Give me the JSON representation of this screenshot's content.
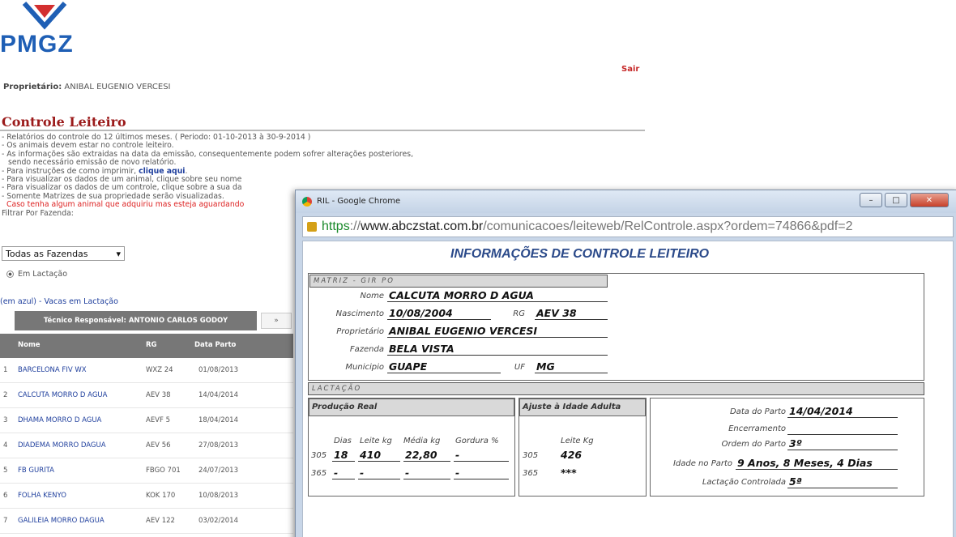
{
  "logo": {
    "text": "PMGZ",
    "mark_icon": "pmgz-logo-icon",
    "color": "#1f5fb5"
  },
  "header": {
    "sair": "Sair",
    "owner_label": "Proprietário:",
    "owner_name": "ANIBAL EUGENIO VERCESI"
  },
  "page_title": "Controle Leiteiro",
  "notes": {
    "l1": "- Relatórios do controle do 12 últimos meses. ( Periodo: 01-10-2013 à 30-9-2014 )",
    "l2": "- Os animais devem estar no controle leiteiro.",
    "l3": "- As informações são extraidas na data da emissão, consequentemente podem sofrer alterações posteriores,",
    "l4": "sendo necessário emissão de novo relatório.",
    "l5_pre": "- Para instruções de como imprimir, ",
    "l5_link": "clique aqui",
    "l5_post": ".",
    "l6": "- Para visualizar os dados de um animal, clique sobre seu nome",
    "l7": "- Para visualizar os dados de um controle, clique sobre a sua da",
    "l8": "- Somente Matrizes de sua propriedade serão visualizadas.",
    "l9": "Caso tenha algum animal que adquiriu mas esteja aguardando"
  },
  "filter": {
    "label": "Filtrar Por Fazenda:",
    "selected": "Todas as Fazendas",
    "radio": "Em Lactação",
    "legend": "(em azul) - Vacas em Lactação"
  },
  "tecnico": {
    "label": "Técnico Responsável: ANTONIO CARLOS GODOY",
    "button": "»"
  },
  "table": {
    "headers": {
      "nome": "Nome",
      "rg": "RG",
      "data": "Data Parto"
    },
    "rows": [
      {
        "n": "1",
        "nome": "BARCELONA FIV WX",
        "rg": "WXZ 24",
        "data": "01/08/2013"
      },
      {
        "n": "2",
        "nome": "CALCUTA MORRO D AGUA",
        "rg": "AEV 38",
        "data": "14/04/2014"
      },
      {
        "n": "3",
        "nome": "DHAMA MORRO D AGUA",
        "rg": "AEVF 5",
        "data": "18/04/2014"
      },
      {
        "n": "4",
        "nome": "DIADEMA MORRO DAGUA",
        "rg": "AEV 56",
        "data": "27/08/2013"
      },
      {
        "n": "5",
        "nome": "FB GURITA",
        "rg": "FBGO 701",
        "data": "24/07/2013"
      },
      {
        "n": "6",
        "nome": "FOLHA KENYO",
        "rg": "KOK 170",
        "data": "10/08/2013"
      },
      {
        "n": "7",
        "nome": "GALILEIA MORRO DAGUA",
        "rg": "AEV 122",
        "data": "03/02/2014"
      }
    ]
  },
  "popup": {
    "title": "RIL - Google Chrome",
    "url_https": "https",
    "url_sep": "://",
    "url_domain": "www.abczstat.com.br",
    "url_path": "/comunicacoes/leiteweb/RelControle.aspx?ordem=74866&pdf=2",
    "report_title": "INFORMAÇÕES DE CONTROLE LEITEIRO",
    "matriz": {
      "section": "MATRIZ - GIR PO",
      "nome_label": "Nome",
      "nome": "CALCUTA MORRO D AGUA",
      "nasc_label": "Nascimento",
      "nasc": "10/08/2004",
      "rg_label": "RG",
      "rg": "AEV 38",
      "prop_label": "Proprietário",
      "prop": "ANIBAL EUGENIO VERCESI",
      "faz_label": "Fazenda",
      "faz": "BELA VISTA",
      "mun_label": "Municipio",
      "mun": "GUAPE",
      "uf_label": "UF",
      "uf": "MG"
    },
    "lactacao": {
      "section": "LACTAÇÃO",
      "prod_header": "Produção Real",
      "cols": {
        "dias": "Dias",
        "leite": "Leite kg",
        "media": "Média kg",
        "gordura": "Gordura %"
      },
      "r305": {
        "label": "305",
        "dias": "18",
        "leite": "410",
        "media": "22,80",
        "gordura": "-"
      },
      "r365": {
        "label": "365",
        "dias": "-",
        "leite": "-",
        "media": "-",
        "gordura": "-"
      },
      "ajuste_header": "Ajuste à Idade Adulta",
      "ajuste_col": "Leite Kg",
      "a305": {
        "label": "305",
        "val": "426"
      },
      "a365": {
        "label": "365",
        "val": "***"
      },
      "data_parto_label": "Data do Parto",
      "data_parto": "14/04/2014",
      "enc_label": "Encerramento",
      "enc": "",
      "ordem_label": "Ordem do Parto",
      "ordem": "3º",
      "idade_label": "Idade no Parto",
      "idade": "9 Anos, 8 Meses, 4 Dias",
      "lact_label": "Lactação Controlada",
      "lact": "5ª"
    }
  }
}
